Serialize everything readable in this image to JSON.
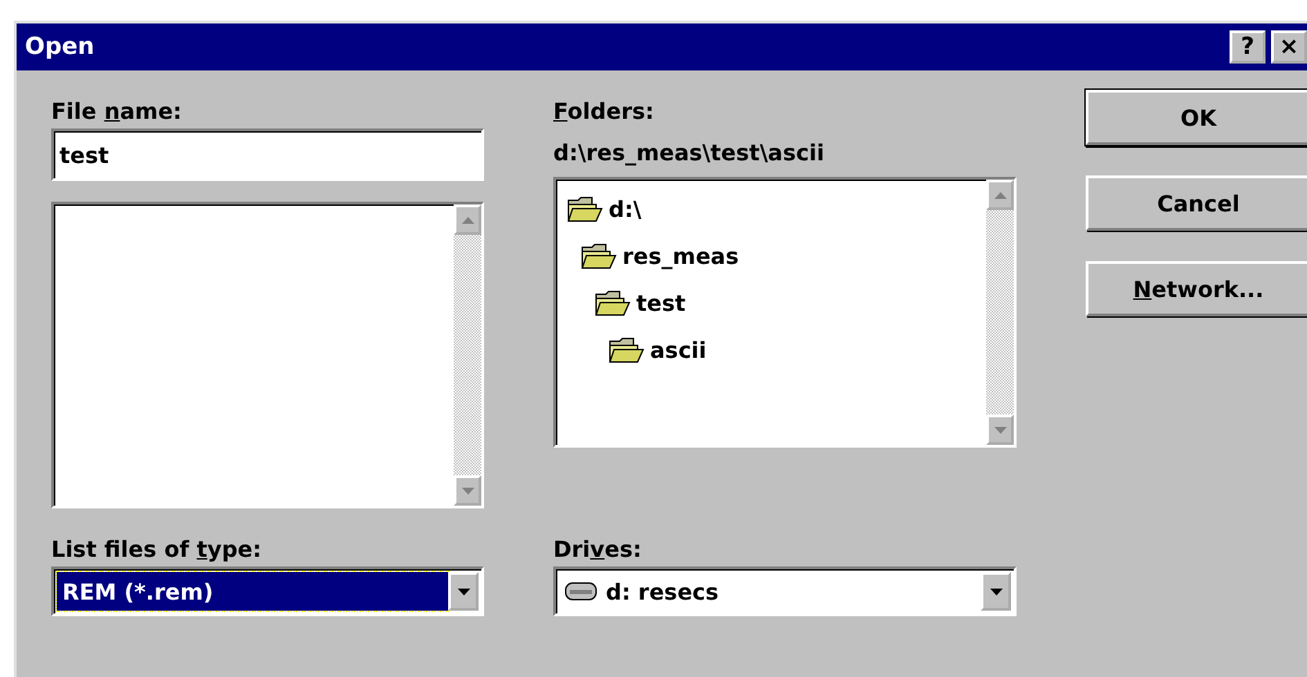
{
  "window": {
    "title": "Open",
    "help_button": "?",
    "close_button": "×"
  },
  "file_name": {
    "label": {
      "before": "File ",
      "key": "n",
      "after": "ame:"
    },
    "value": "test"
  },
  "folders": {
    "label": {
      "key": "F",
      "after": "olders:"
    },
    "path": "d:\\res_meas\\test\\ascii",
    "tree": [
      {
        "name": "d:\\",
        "children": [
          {
            "name": "res_meas",
            "children": [
              {
                "name": "test",
                "children": [
                  {
                    "name": "ascii"
                  }
                ]
              }
            ]
          }
        ]
      }
    ]
  },
  "file_type": {
    "label": {
      "before": "List files of ",
      "key": "t",
      "after": "ype:"
    },
    "value": "REM (*.rem)"
  },
  "drives": {
    "label": {
      "before": "Dri",
      "key": "v",
      "after": "es:"
    },
    "value": "d: resecs"
  },
  "buttons": [
    {
      "label": {
        "before": "OK"
      },
      "default": true
    },
    {
      "label": {
        "before": "Cancel"
      },
      "default": false
    },
    {
      "label": {
        "key": "N",
        "after": "etwork..."
      },
      "default": false
    }
  ]
}
